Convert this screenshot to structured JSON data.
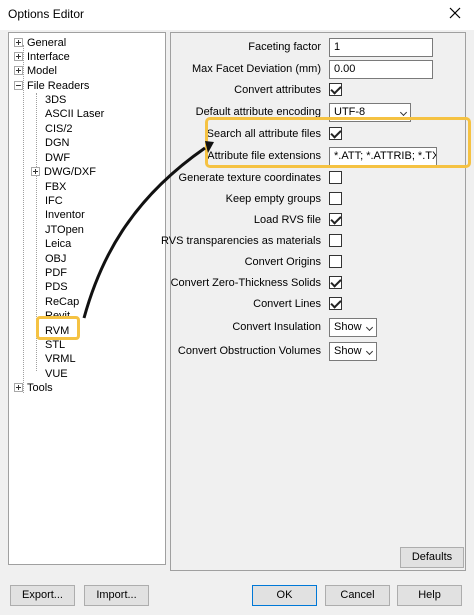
{
  "window": {
    "title": "Options Editor"
  },
  "tree": {
    "top_items": [
      {
        "label": "General"
      },
      {
        "label": "Interface"
      },
      {
        "label": "Model"
      },
      {
        "label": "File Readers"
      }
    ],
    "file_readers": [
      "3DS",
      "ASCII Laser",
      "CIS/2",
      "DGN",
      "DWF",
      "DWG/DXF",
      "FBX",
      "IFC",
      "Inventor",
      "JTOpen",
      "Leica",
      "OBJ",
      "PDF",
      "PDS",
      "ReCap",
      "Revit",
      "RVM",
      "STL",
      "VRML",
      "VUE"
    ],
    "tools": "Tools"
  },
  "settings": {
    "faceting_factor": {
      "label": "Faceting factor",
      "value": "1"
    },
    "max_facet_deviation": {
      "label": "Max Facet Deviation (mm)",
      "value": "0.00"
    },
    "convert_attributes": {
      "label": "Convert attributes",
      "checked": true
    },
    "default_attribute_encoding": {
      "label": "Default attribute encoding",
      "value": "UTF-8"
    },
    "search_all_attribute_files": {
      "label": "Search all attribute files",
      "checked": true
    },
    "attribute_file_extensions": {
      "label": "Attribute file extensions",
      "value": "*.ATT; *.ATTRIB; *.TXT"
    },
    "generate_texture_coordinates": {
      "label": "Generate texture coordinates",
      "checked": false
    },
    "keep_empty_groups": {
      "label": "Keep empty groups",
      "checked": false
    },
    "load_rvs_file": {
      "label": "Load RVS file",
      "checked": true
    },
    "rvs_transparencies": {
      "label": "RVS transparencies as materials",
      "checked": false
    },
    "convert_origins": {
      "label": "Convert Origins",
      "checked": false
    },
    "convert_zero_thickness": {
      "label": "Convert Zero-Thickness Solids",
      "checked": true
    },
    "convert_lines": {
      "label": "Convert Lines",
      "checked": true
    },
    "convert_insulation": {
      "label": "Convert Insulation",
      "value": "Show"
    },
    "convert_obstruction": {
      "label": "Convert Obstruction Volumes",
      "value": "Show"
    }
  },
  "buttons": {
    "defaults": "Defaults",
    "export": "Export...",
    "import": "Import...",
    "ok": "OK",
    "cancel": "Cancel",
    "help": "Help"
  },
  "colors": {
    "highlight": "#f5c242",
    "accent": "#0078d7"
  }
}
